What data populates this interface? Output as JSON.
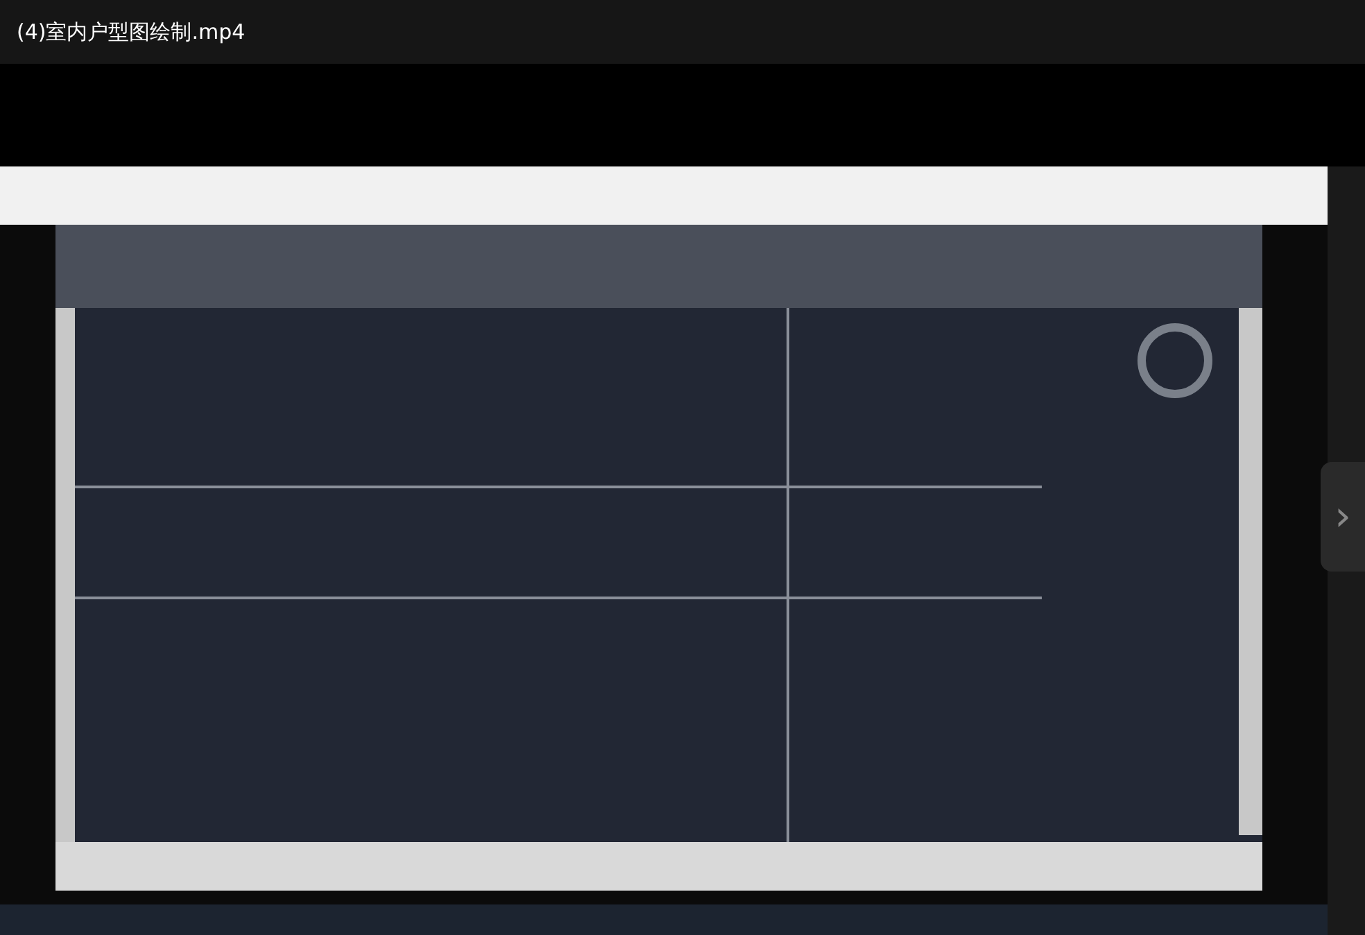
{
  "title": "(4)室内户型图绘制.mp4",
  "next_button": {
    "glyph": "›"
  }
}
